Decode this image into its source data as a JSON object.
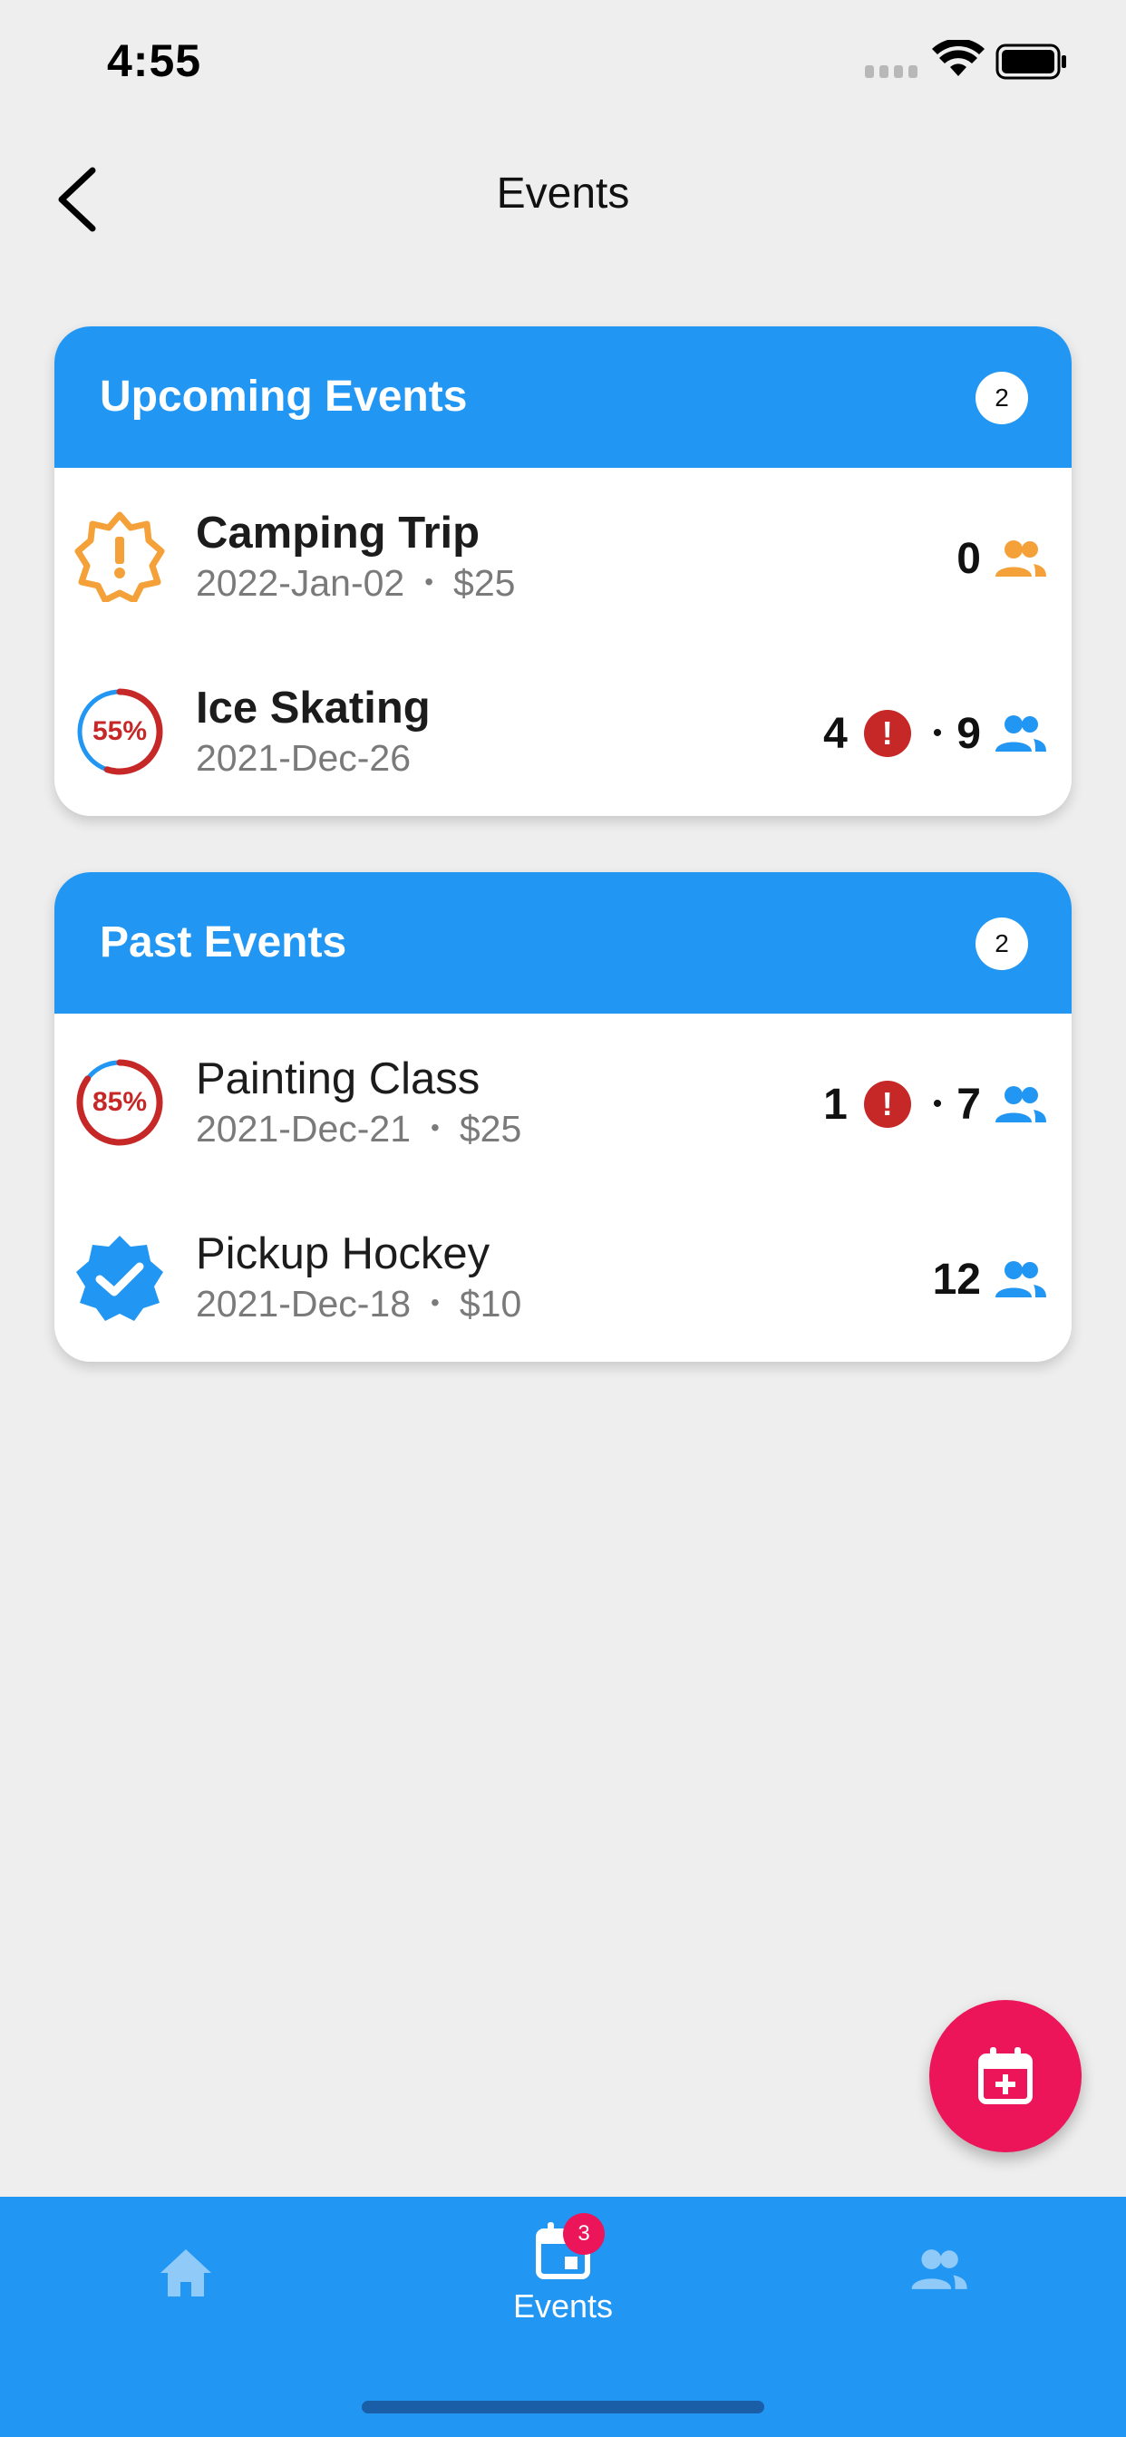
{
  "status_bar": {
    "time": "4:55"
  },
  "nav": {
    "title": "Events"
  },
  "sections": [
    {
      "title": "Upcoming Events",
      "count": "2",
      "events": [
        {
          "name": "Camping Trip",
          "date": "2022-Jan-02",
          "price": "$25",
          "status_icon": "warning-badge-icon",
          "pending": "",
          "attendees": "0",
          "people_color": "#f5a13a"
        },
        {
          "name": "Ice Skating",
          "date": "2021-Dec-26",
          "price": "",
          "status_icon": "progress-ring",
          "progress": "55%",
          "progress_value": 0.55,
          "pending": "4",
          "attendees": "9",
          "people_color": "#2196f3"
        }
      ]
    },
    {
      "title": "Past Events",
      "count": "2",
      "events": [
        {
          "name": "Painting Class",
          "date": "2021-Dec-21",
          "price": "$25",
          "status_icon": "progress-ring",
          "progress": "85%",
          "progress_value": 0.85,
          "pending": "1",
          "attendees": "7",
          "people_color": "#2196f3"
        },
        {
          "name": "Pickup Hockey",
          "date": "2021-Dec-18",
          "price": "$10",
          "status_icon": "verified-badge-icon",
          "pending": "",
          "attendees": "12",
          "people_color": "#2196f3"
        }
      ]
    }
  ],
  "alert_glyph": "!",
  "separator": "•",
  "fab": {
    "icon": "calendar-add-icon"
  },
  "tabs": [
    {
      "icon": "home-icon",
      "label": ""
    },
    {
      "icon": "calendar-icon",
      "label": "Events",
      "badge": "3"
    },
    {
      "icon": "people-icon",
      "label": ""
    }
  ],
  "colors": {
    "primary": "#2196f3",
    "accent": "#ec1559",
    "warning": "#f5a13a",
    "alert": "#c62828"
  }
}
